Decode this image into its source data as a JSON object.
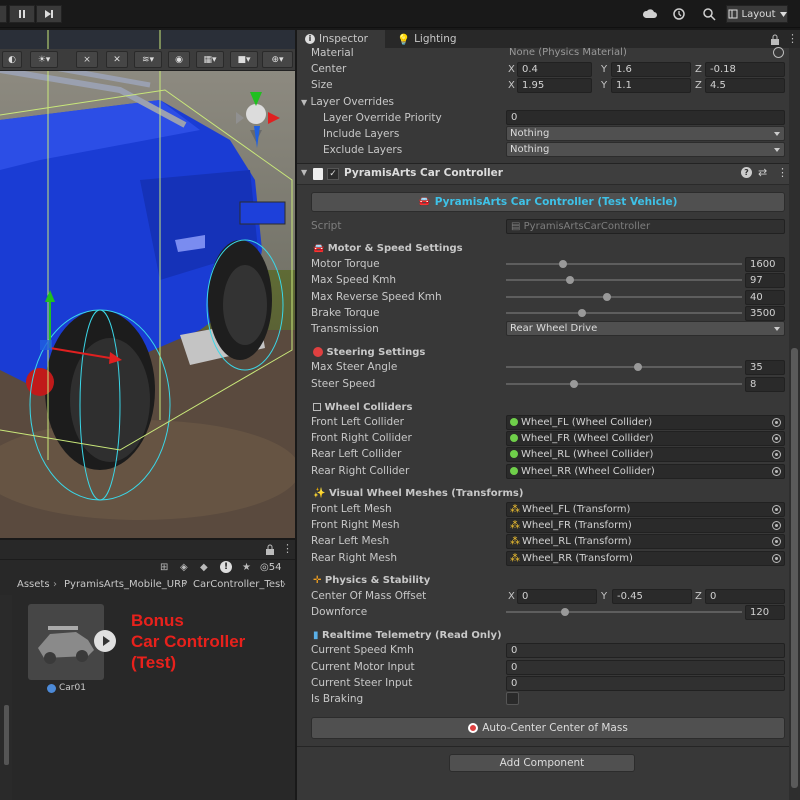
{
  "toolbar": {
    "layout_label": "Layout"
  },
  "inspector": {
    "tabs": [
      {
        "label": "Inspector"
      },
      {
        "label": "Lighting"
      }
    ],
    "collider": {
      "material_label": "Material",
      "material_value": "None (Physics Material)",
      "center_label": "Center",
      "center": {
        "x": "0.4",
        "y": "1.6",
        "z": "-0.18"
      },
      "size_label": "Size",
      "size": {
        "x": "1.95",
        "y": "1.1",
        "z": "4.5"
      },
      "layer_overrides_label": "Layer Overrides",
      "priority_label": "Layer Override Priority",
      "priority_value": "0",
      "include_label": "Include Layers",
      "include_value": "Nothing",
      "exclude_label": "Exclude Layers",
      "exclude_value": "Nothing"
    },
    "component": {
      "title": "PyramisArts Car Controller",
      "header_button": "PyramisArts Car Controller (Test Vehicle)",
      "script_label": "Script",
      "script_value": "PyramisArtsCarController",
      "motor_section": "Motor & Speed Settings",
      "motor_fields": [
        {
          "label": "Motor Torque",
          "value": "1600",
          "fraction": 0.24
        },
        {
          "label": "Max Speed Kmh",
          "value": "97",
          "fraction": 0.27
        },
        {
          "label": "Max Reverse Speed Kmh",
          "value": "40",
          "fraction": 0.43
        },
        {
          "label": "Brake Torque",
          "value": "3500",
          "fraction": 0.32
        }
      ],
      "transmission_label": "Transmission",
      "transmission_value": "Rear Wheel Drive",
      "steering_section": "Steering Settings",
      "steering_fields": [
        {
          "label": "Max Steer Angle",
          "value": "35",
          "fraction": 0.56
        },
        {
          "label": "Steer Speed",
          "value": "8",
          "fraction": 0.29
        }
      ],
      "colliders_section": "Wheel Colliders",
      "colliders": [
        {
          "label": "Front Left Collider",
          "value": "Wheel_FL (Wheel Collider)"
        },
        {
          "label": "Front Right Collider",
          "value": "Wheel_FR (Wheel Collider)"
        },
        {
          "label": "Rear Left Collider",
          "value": "Wheel_RL (Wheel Collider)"
        },
        {
          "label": "Rear Right Collider",
          "value": "Wheel_RR (Wheel Collider)"
        }
      ],
      "meshes_section": "Visual Wheel Meshes (Transforms)",
      "meshes": [
        {
          "label": "Front Left Mesh",
          "value": "Wheel_FL (Transform)"
        },
        {
          "label": "Front Right Mesh",
          "value": "Wheel_FR (Transform)"
        },
        {
          "label": "Rear Left Mesh",
          "value": "Wheel_RL (Transform)"
        },
        {
          "label": "Rear Right Mesh",
          "value": "Wheel_RR (Transform)"
        }
      ],
      "physics_section": "Physics & Stability",
      "com_label": "Center Of Mass Offset",
      "com": {
        "x": "0",
        "y": "-0.45",
        "z": "0"
      },
      "downforce_label": "Downforce",
      "downforce_value": "120",
      "downforce_fraction": 0.25,
      "telemetry_section": "Realtime Telemetry (Read Only)",
      "telemetry": [
        {
          "label": "Current Speed Kmh",
          "value": "0"
        },
        {
          "label": "Current Motor Input",
          "value": "0"
        },
        {
          "label": "Current Steer Input",
          "value": "0"
        }
      ],
      "braking_label": "Is Braking",
      "auto_center_button": "Auto-Center Center of Mass"
    },
    "add_component": "Add Component"
  },
  "project": {
    "badge_count": "54",
    "breadcrumb": [
      "Assets",
      "PyramisArts_Mobile_URP",
      "CarController_Test"
    ],
    "asset_name": "Car01",
    "overlay_text": [
      "Bonus",
      "Car Controller",
      "(Test)"
    ]
  },
  "colors": {
    "accent_cyan": "#3ec2e8",
    "overlay_red": "#e8211c",
    "car_blue": "#1a3cd4"
  }
}
